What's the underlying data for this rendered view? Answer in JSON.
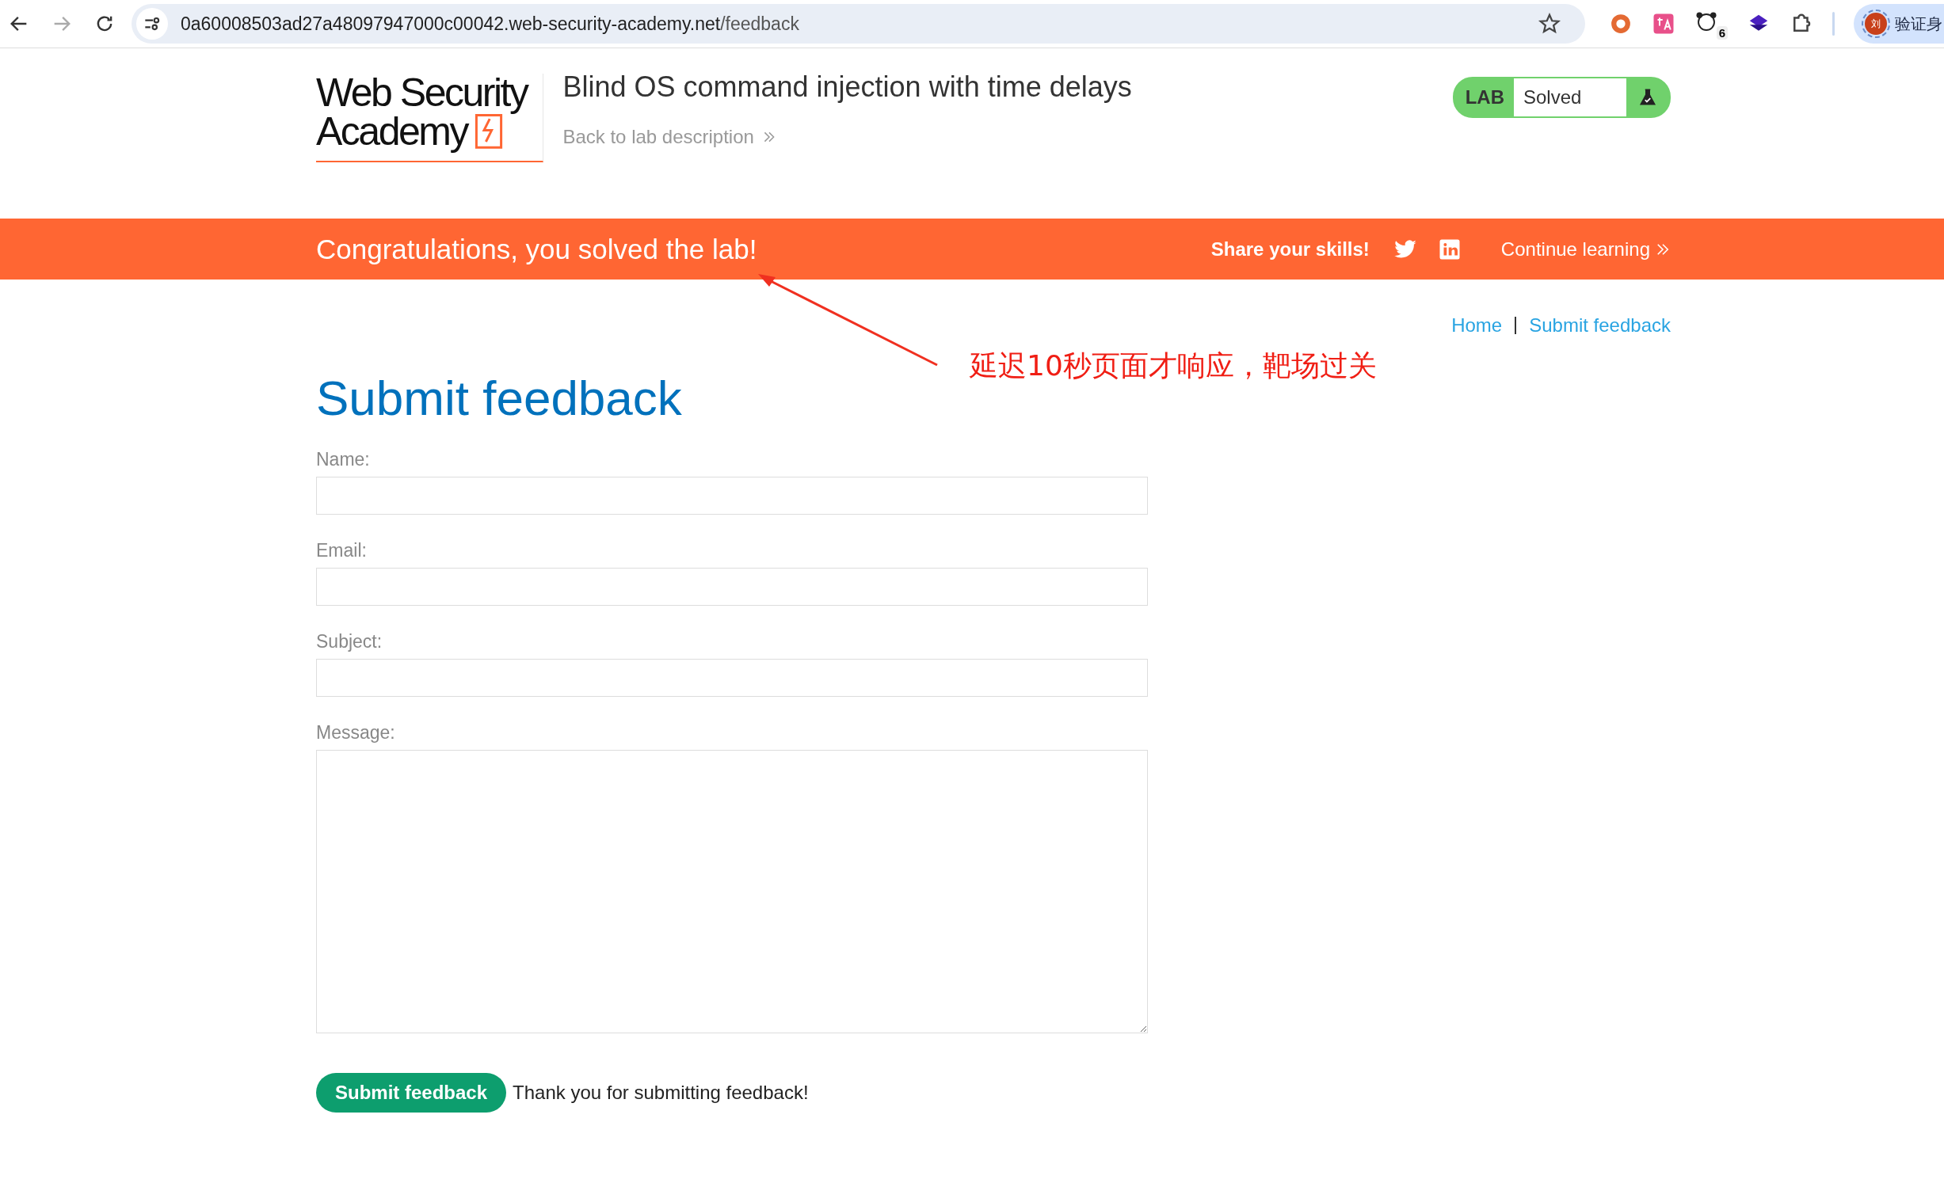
{
  "browser": {
    "nav": [
      {
        "kind": "back",
        "disabled": false
      },
      {
        "kind": "forward",
        "disabled": true
      },
      {
        "kind": "reload",
        "disabled": false
      }
    ],
    "url": {
      "host": "0a60008503ad27a48097947000c00042.web-security-academy.net",
      "path": "/feedback"
    },
    "extensions": [
      {
        "kind": "ring"
      },
      {
        "kind": "translate"
      },
      {
        "kind": "panda",
        "badge": "6"
      },
      {
        "kind": "layers"
      },
      {
        "kind": "puzzle"
      }
    ],
    "profile": {
      "avatar": "刘",
      "label": "验证身"
    }
  },
  "header": {
    "logo": {
      "line_1": "Web Security",
      "line_2": "Academy"
    },
    "title": "Blind OS command injection with time delays",
    "back_link": "Back to lab description",
    "badge": {
      "label": "LAB",
      "status": "Solved",
      "solved": true
    }
  },
  "banner": {
    "message": "Congratulations, you solved the lab!",
    "share": "Share your skills!",
    "continue": "Continue learning"
  },
  "breadcrumb": [
    "Home",
    "Submit feedback"
  ],
  "annotation": {
    "text": "延迟10秒页面才响应，靶场过关"
  },
  "heading": "Submit feedback",
  "form": {
    "fields": [
      {
        "label": "Name:",
        "kind": "input"
      },
      {
        "label": "Email:",
        "kind": "input"
      },
      {
        "label": "Subject:",
        "kind": "input"
      },
      {
        "label": "Message:",
        "kind": "textarea"
      }
    ],
    "submit": "Submit feedback",
    "result": "Thank you for submitting feedback!"
  }
}
